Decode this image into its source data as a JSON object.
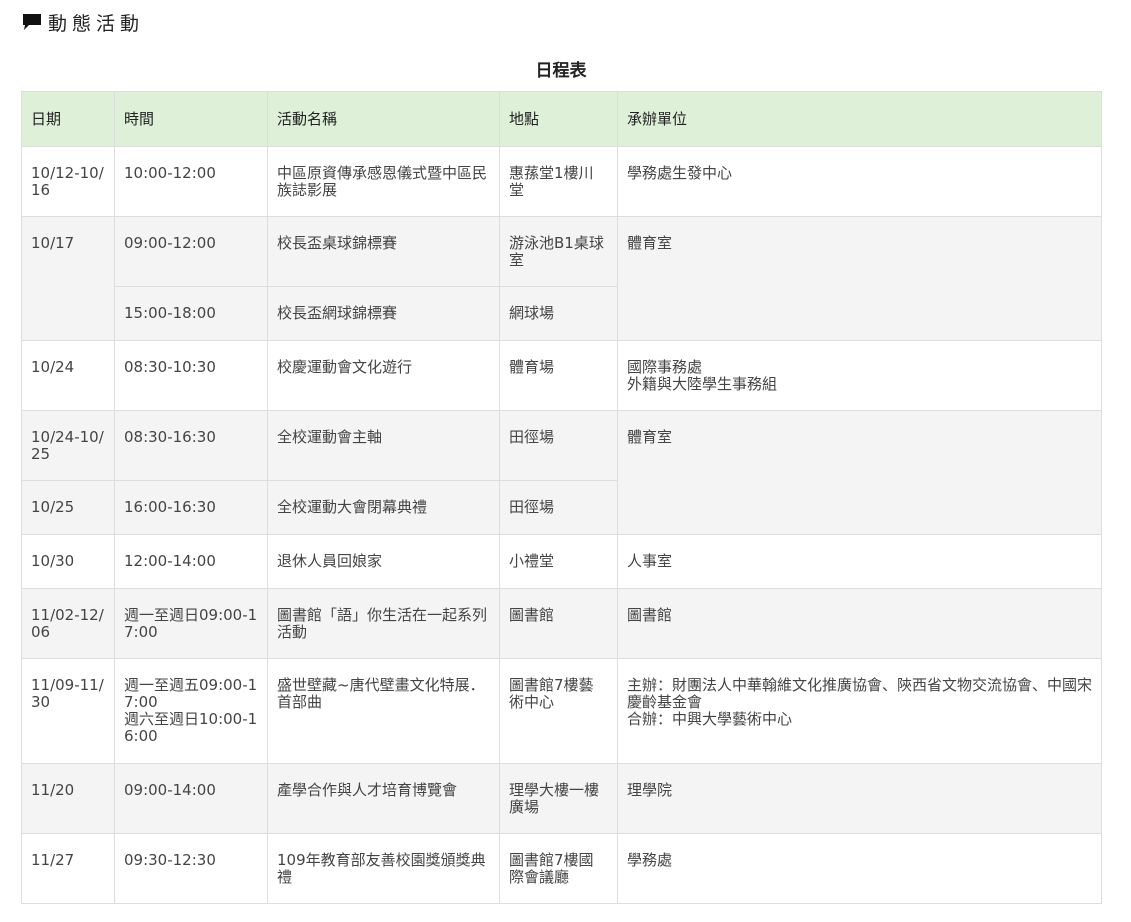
{
  "header": {
    "title": "動態活動",
    "icon": "speech-bubble-icon"
  },
  "table": {
    "caption": "日程表",
    "columns": [
      "日期",
      "時間",
      "活動名稱",
      "地點",
      "承辦單位"
    ],
    "rows": [
      {
        "date": "10/12-10/16",
        "time": "10:00-12:00",
        "event": "中區原資傳承感恩儀式暨中區民族誌影展",
        "location": "惠蓀堂1樓川堂",
        "organizer": "學務處生發中心"
      },
      {
        "date": "10/17",
        "time": "09:00-12:00",
        "event": "校長盃桌球錦標賽",
        "location": "游泳池B1桌球室",
        "organizer": "體育室"
      },
      {
        "time": "15:00-18:00",
        "event": "校長盃網球錦標賽",
        "location": "網球場"
      },
      {
        "date": "10/24",
        "time": "08:30-10:30",
        "event": "校慶運動會文化遊行",
        "location": "體育場",
        "organizer_lines": [
          "國際事務處",
          "外籍與大陸學生事務組"
        ]
      },
      {
        "date": "10/24-10/25",
        "time": "08:30-16:30",
        "event": "全校運動會主軸",
        "location": "田徑場",
        "organizer": "體育室"
      },
      {
        "date": "10/25",
        "time": "16:00-16:30",
        "event": "全校運動大會閉幕典禮",
        "location": "田徑場"
      },
      {
        "date": "10/30",
        "time": "12:00-14:00",
        "event": "退休人員回娘家",
        "location": "小禮堂",
        "organizer": "人事室"
      },
      {
        "date": "11/02-12/06",
        "time": "週一至週日09:00-17:00",
        "event": "圖書館「語」你生活在一起系列活動",
        "location": "圖書館",
        "organizer": "圖書館"
      },
      {
        "date": "11/09-11/30",
        "time_lines": [
          "週一至週五09:00-17:00",
          "週六至週日10:00-16:00"
        ],
        "event": "盛世壁藏~唐代壁畫文化特展．首部曲",
        "location": "圖書館7樓藝術中心",
        "organizer_lines": [
          "主辦：財團法人中華翰維文化推廣協會、陝西省文物交流協會、中國宋慶齡基金會",
          "合辦：中興大學藝術中心"
        ]
      },
      {
        "date": "11/20",
        "time": "09:00-14:00",
        "event": "產學合作與人才培育博覽會",
        "location": "理學大樓一樓廣場",
        "organizer": "理學院"
      },
      {
        "date": "11/27",
        "time": "09:30-12:30",
        "event": "109年教育部友善校園獎頒獎典禮",
        "location": "圖書館7樓國際會議廳",
        "organizer": "學務處"
      }
    ]
  }
}
